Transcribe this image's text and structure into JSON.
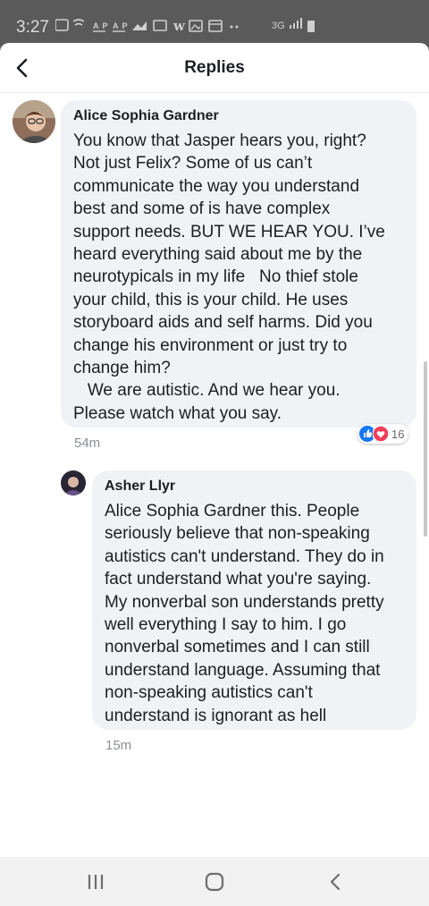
{
  "status_bar": {
    "time": "3:27",
    "icons": [
      "message-icon",
      "wifi-calling-icon",
      "ap-news-icon",
      "ap-news-icon",
      "chart-icon",
      "news-icon",
      "w-icon",
      "image-icon",
      "calendar-icon"
    ],
    "network": "3G",
    "battery": "battery-icon"
  },
  "header": {
    "title": "Replies",
    "back_icon": "chevron-left-icon"
  },
  "comments": [
    {
      "author": "Alice Sophia Gardner",
      "text": "You know that Jasper hears you, right?\nNot just Felix? Some of us can’t\ncommunicate the way you understand\nbest and some of is have complex\nsupport needs. BUT WE HEAR YOU. I’ve\nheard everything said about me by the\nneurotypicals in my life   No thief stole\nyour child, this is your child. He uses\nstoryboard aids and self harms. Did you\nchange his environment or just try to\nchange him?\n   We are autistic. And we hear you.\nPlease watch what you say.",
      "time": "54m",
      "reactions": {
        "types": [
          "like",
          "love"
        ],
        "count": "16",
        "colors": {
          "like": "#1877f2",
          "love": "#f33e58"
        }
      }
    },
    {
      "author": "Asher Llyr",
      "text": "Alice Sophia Gardner this. People\nseriously believe that non-speaking\nautistics can't understand. They do in\nfact understand what you're saying.\nMy nonverbal son understands pretty\nwell everything I say to him. I go\nnonverbal sometimes and I can still\nunderstand language. Assuming that\nnon-speaking autistics can't\nunderstand is ignorant as hell",
      "time": "15m"
    }
  ],
  "nav_bar": {
    "buttons": [
      "recent-apps-icon",
      "home-icon",
      "back-icon"
    ]
  }
}
